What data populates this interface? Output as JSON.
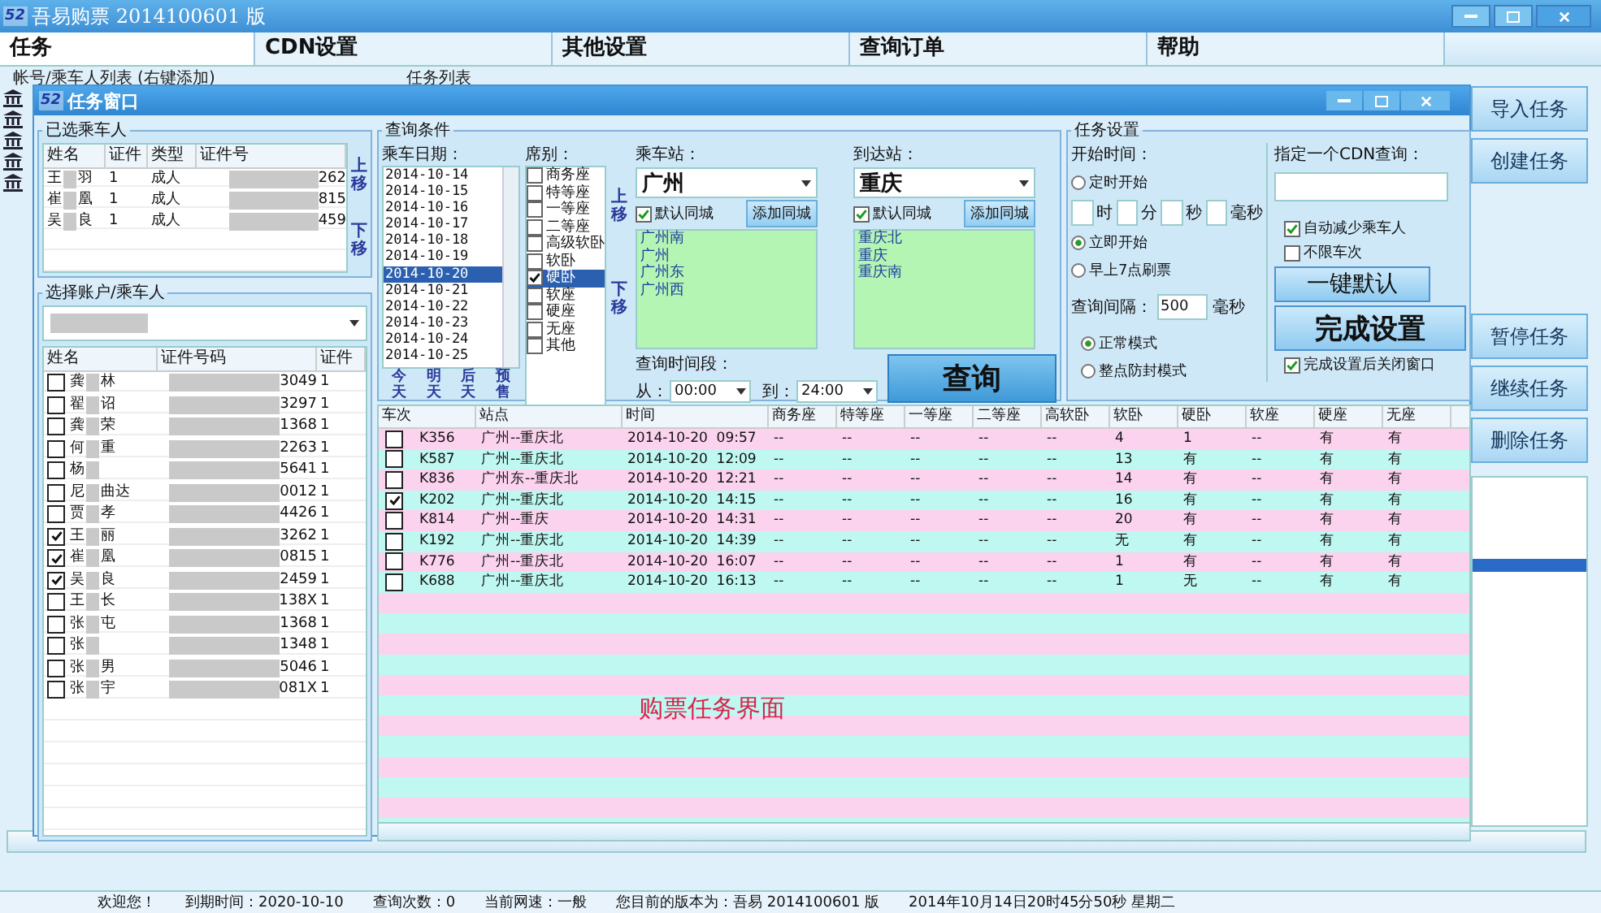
{
  "window": {
    "logo": "52",
    "title": "吾易购票 2014100601 版"
  },
  "menu": [
    {
      "label": "任务",
      "selected": true
    },
    {
      "label": "CDN设置",
      "selected": false
    },
    {
      "label": "其他设置",
      "selected": false
    },
    {
      "label": "查询订单",
      "selected": false
    },
    {
      "label": "帮助",
      "selected": false
    }
  ],
  "accounts_label": "帐号/乘车人列表 (右键添加)",
  "tasks_label": "任务列表",
  "side_buttons": [
    "导入任务",
    "创建任务",
    "暂停任务",
    "继续任务",
    "删除任务"
  ],
  "dialog": {
    "logo": "52",
    "title": "任务窗口",
    "selected_passengers": {
      "title": "已选乘车人",
      "columns": [
        "姓名",
        "证件",
        "类型",
        "证件号"
      ],
      "move_up": "上移",
      "move_down": "下移",
      "rows": [
        {
          "name_start": "王",
          "name_end": "羽",
          "doc_type": "1",
          "type": "成人",
          "id_tail": "262"
        },
        {
          "name_start": "崔",
          "name_end": "凰",
          "doc_type": "1",
          "type": "成人",
          "id_tail": "815"
        },
        {
          "name_start": "吴",
          "name_end": "良",
          "doc_type": "1",
          "type": "成人",
          "id_tail": "459"
        }
      ]
    },
    "account_picker": {
      "title": "选择账户/乘车人",
      "columns": [
        "姓名",
        "证件号码",
        "证件"
      ],
      "rows": [
        {
          "checked": false,
          "name_start": "龚",
          "name_end": "林",
          "id_tail": "3049",
          "doc_type": "1"
        },
        {
          "checked": false,
          "name_start": "翟",
          "name_end": "诏",
          "id_tail": "3297",
          "doc_type": "1"
        },
        {
          "checked": false,
          "name_start": "龚",
          "name_end": "荣",
          "id_tail": "1368",
          "doc_type": "1"
        },
        {
          "checked": false,
          "name_start": "何",
          "name_end": "重",
          "id_tail": "2263",
          "doc_type": "1"
        },
        {
          "checked": false,
          "name_start": "杨",
          "name_end": "",
          "id_tail": "5641",
          "doc_type": "1"
        },
        {
          "checked": false,
          "name_start": "尼",
          "name_end": "曲达",
          "id_tail": "0012",
          "doc_type": "1"
        },
        {
          "checked": false,
          "name_start": "贾",
          "name_end": "孝",
          "id_tail": "4426",
          "doc_type": "1"
        },
        {
          "checked": true,
          "name_start": "王",
          "name_end": "丽",
          "id_tail": "3262",
          "doc_type": "1"
        },
        {
          "checked": true,
          "name_start": "崔",
          "name_end": "凰",
          "id_tail": "0815",
          "doc_type": "1"
        },
        {
          "checked": true,
          "name_start": "吴",
          "name_end": "良",
          "id_tail": "2459",
          "doc_type": "1"
        },
        {
          "checked": false,
          "name_start": "王",
          "name_end": "长",
          "id_tail": "138X",
          "doc_type": "1"
        },
        {
          "checked": false,
          "name_start": "张",
          "name_end": "屯",
          "id_tail": "1368",
          "doc_type": "1"
        },
        {
          "checked": false,
          "name_start": "张",
          "name_end": "",
          "id_tail": "1348",
          "doc_type": "1"
        },
        {
          "checked": false,
          "name_start": "张",
          "name_end": "男",
          "id_tail": "5046",
          "doc_type": "1"
        },
        {
          "checked": false,
          "name_start": "张",
          "name_end": "宇",
          "id_tail": "081X",
          "doc_type": "1"
        }
      ]
    },
    "query": {
      "title": "查询条件",
      "date_label": "乘车日期：",
      "dates": [
        {
          "label": "2014-10-14",
          "selected": false
        },
        {
          "label": "2014-10-15",
          "selected": false
        },
        {
          "label": "2014-10-16",
          "selected": false
        },
        {
          "label": "2014-10-17",
          "selected": false
        },
        {
          "label": "2014-10-18",
          "selected": false
        },
        {
          "label": "2014-10-19",
          "selected": false
        },
        {
          "label": "2014-10-20",
          "selected": true
        },
        {
          "label": "2014-10-21",
          "selected": false
        },
        {
          "label": "2014-10-22",
          "selected": false
        },
        {
          "label": "2014-10-23",
          "selected": false
        },
        {
          "label": "2014-10-24",
          "selected": false
        },
        {
          "label": "2014-10-25",
          "selected": false
        }
      ],
      "quick_dates": [
        "今天",
        "明天",
        "后天",
        "预售"
      ],
      "seat_label": "席别：",
      "seats": [
        {
          "label": "商务座",
          "checked": false,
          "selected": false
        },
        {
          "label": "特等座",
          "checked": false,
          "selected": false
        },
        {
          "label": "一等座",
          "checked": false,
          "selected": false
        },
        {
          "label": "二等座",
          "checked": false,
          "selected": false
        },
        {
          "label": "高级软卧",
          "checked": false,
          "selected": false
        },
        {
          "label": "软卧",
          "checked": false,
          "selected": false
        },
        {
          "label": "硬卧",
          "checked": true,
          "selected": true
        },
        {
          "label": "软座",
          "checked": false,
          "selected": false
        },
        {
          "label": "硬座",
          "checked": false,
          "selected": false
        },
        {
          "label": "无座",
          "checked": false,
          "selected": false
        },
        {
          "label": "其他",
          "checked": false,
          "selected": false
        }
      ],
      "move_up": "上移",
      "move_down": "下移",
      "stations": [
        {
          "label": "乘车站：",
          "value": "广州",
          "same_city": {
            "label": "默认同城",
            "checked": true
          },
          "add_button": "添加同城",
          "list": [
            "广州南",
            "广州",
            "广州东",
            "广州西"
          ]
        },
        {
          "label": "到达站：",
          "value": "重庆",
          "same_city": {
            "label": "默认同城",
            "checked": true
          },
          "add_button": "添加同城",
          "list": [
            "重庆北",
            "重庆",
            "重庆南"
          ]
        }
      ],
      "time_label": "查询时间段：",
      "time_from_label": "从：",
      "time_from": "00:00",
      "time_to_label": "到：",
      "time_to": "24:00",
      "search_button": "查询"
    },
    "task_settings": {
      "title": "任务设置",
      "start_label": "开始时间：",
      "start_modes": [
        {
          "label": "定时开始",
          "selected": false
        },
        {
          "label": "立即开始",
          "selected": true
        },
        {
          "label": "早上7点刷票",
          "selected": false
        }
      ],
      "time_units": [
        "时",
        "分",
        "秒",
        "毫秒"
      ],
      "interval_label": "查询间隔：",
      "interval": "500",
      "interval_unit": "毫秒",
      "modes": [
        {
          "label": "正常模式",
          "selected": true
        },
        {
          "label": "整点防封模式",
          "selected": false
        }
      ],
      "cdn_label": "指定一个CDN查询：",
      "options": [
        {
          "label": "自动减少乘车人",
          "checked": true
        },
        {
          "label": "不限车次",
          "checked": false
        }
      ],
      "default_button": "一键默认",
      "finish_button": "完成设置",
      "close_after": {
        "label": "完成设置后关闭窗口",
        "checked": true
      }
    },
    "trains": {
      "columns": [
        "车次",
        "站点",
        "时间",
        "商务座",
        "特等座",
        "一等座",
        "二等座",
        "高软卧",
        "软卧",
        "硬卧",
        "软座",
        "硬座",
        "无座"
      ],
      "rows": [
        {
          "checked": false,
          "cells": [
            "K356",
            "广州--重庆北",
            "2014-10-20  09:57",
            "--",
            "--",
            "--",
            "--",
            "--",
            "4",
            "1",
            "--",
            "有",
            "有"
          ]
        },
        {
          "checked": false,
          "cells": [
            "K587",
            "广州--重庆北",
            "2014-10-20  12:09",
            "--",
            "--",
            "--",
            "--",
            "--",
            "13",
            "有",
            "--",
            "有",
            "有"
          ]
        },
        {
          "checked": false,
          "cells": [
            "K836",
            "广州东--重庆北",
            "2014-10-20  12:21",
            "--",
            "--",
            "--",
            "--",
            "--",
            "14",
            "有",
            "--",
            "有",
            "有"
          ]
        },
        {
          "checked": true,
          "cells": [
            "K202",
            "广州--重庆北",
            "2014-10-20  14:15",
            "--",
            "--",
            "--",
            "--",
            "--",
            "16",
            "有",
            "--",
            "有",
            "有"
          ]
        },
        {
          "checked": false,
          "cells": [
            "K814",
            "广州--重庆",
            "2014-10-20  14:31",
            "--",
            "--",
            "--",
            "--",
            "--",
            "20",
            "有",
            "--",
            "有",
            "有"
          ]
        },
        {
          "checked": false,
          "cells": [
            "K192",
            "广州--重庆北",
            "2014-10-20  14:39",
            "--",
            "--",
            "--",
            "--",
            "--",
            "无",
            "有",
            "--",
            "有",
            "有"
          ]
        },
        {
          "checked": false,
          "cells": [
            "K776",
            "广州--重庆北",
            "2014-10-20  16:07",
            "--",
            "--",
            "--",
            "--",
            "--",
            "1",
            "有",
            "--",
            "有",
            "有"
          ]
        },
        {
          "checked": false,
          "cells": [
            "K688",
            "广州--重庆北",
            "2014-10-20  16:13",
            "--",
            "--",
            "--",
            "--",
            "--",
            "1",
            "无",
            "--",
            "有",
            "有"
          ]
        }
      ],
      "note": "购票任务界面"
    }
  },
  "status_bar": [
    "欢迎您！",
    "到期时间：2020-10-10",
    "查询次数：0",
    "当前网速：一般",
    "您目前的版本为：吾易 2014100601 版",
    "2014年10月14日20时45分50秒 星期二"
  ]
}
